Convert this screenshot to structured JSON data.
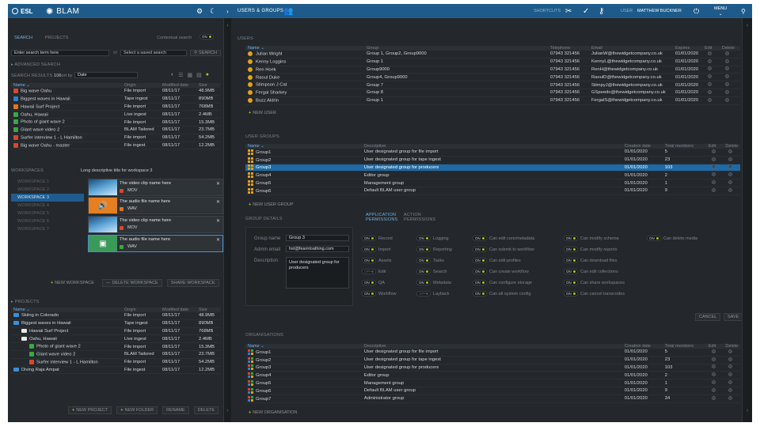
{
  "topbar": {
    "brand": "ESL",
    "app": "BLAM",
    "section": "USERS & GROUPS",
    "shortcuts": "SHORTCUTS",
    "user_label": "USER",
    "user_name": "MATTHEW BUCKNER",
    "menu": "MENU"
  },
  "left": {
    "tabs": [
      "SEARCH",
      "PROJECTS"
    ],
    "contextual": "Contextual search",
    "ctx_state": "ON",
    "search_placeholder": "Enter search term here",
    "or": "or",
    "saved_placeholder": "Select a saved search",
    "search_btn": "SEARCH",
    "advanced": "ADVANCED SEARCH",
    "results_label": "SEARCH RESULTS",
    "results_count": "106",
    "sort_label": "Sort by",
    "sort_value": "Date",
    "results_headers": [
      "Name",
      "Origin",
      "Modified date",
      "Size"
    ],
    "results": [
      {
        "icon": "red",
        "name": "Big wave Oahu",
        "origin": "File import",
        "date": "08/11/17",
        "size": "48.9MB"
      },
      {
        "icon": "blue",
        "name": "Biggest waves in Hawaii",
        "origin": "Tape ingest",
        "date": "08/11/17",
        "size": "890MB"
      },
      {
        "icon": "orange",
        "name": "Hawaii Surf Project",
        "origin": "File import",
        "date": "08/11/17",
        "size": "768MB"
      },
      {
        "icon": "green",
        "name": "Oahu, Hawaii",
        "origin": "Live ingest",
        "date": "08/11/17",
        "size": "2.4MB"
      },
      {
        "icon": "green",
        "name": "Photo of giant wave 2",
        "origin": "File import",
        "date": "08/11/17",
        "size": "15.3MB"
      },
      {
        "icon": "green",
        "name": "Giant wave video 2",
        "origin": "BLAM Tailored",
        "date": "08/11/17",
        "size": "23.7MB"
      },
      {
        "icon": "red",
        "name": "Surfer interview 1 - L Hamilton",
        "origin": "File import",
        "date": "08/11/17",
        "size": "54.2MB"
      },
      {
        "icon": "red",
        "name": "Big wave Oahu - master",
        "origin": "File ingest",
        "date": "08/11/17",
        "size": "12.2MB"
      }
    ],
    "workspaces_label": "WORKSPACES",
    "ws_title": "Long descriptive title for workspace 3",
    "workspaces": [
      "WORKSPACE 1",
      "WORKSPACE 2",
      "WORKSPACE 3",
      "WORKSPACE 4",
      "WORKSPACE 5",
      "WORKSPACE 6",
      "WORKSPACE 7"
    ],
    "cards": [
      {
        "title": "The video clip name here",
        "type": "MOV",
        "kind": "video"
      },
      {
        "title": "The audio file name here",
        "type": "WAV",
        "kind": "audio"
      },
      {
        "title": "The video clip name here",
        "type": "MOV",
        "kind": "video"
      },
      {
        "title": "The audio file name here",
        "type": "WAV",
        "kind": "image"
      }
    ],
    "ws_buttons": [
      "NEW WORKSPACE",
      "DELETE WORKSPACE",
      "SHARE WORKSPACE"
    ],
    "projects_label": "PROJECTS",
    "projects_headers": [
      "Name",
      "Origin",
      "Modified date",
      "Size"
    ],
    "projects": [
      {
        "icon": "folder",
        "indent": 0,
        "name": "Skiing in Colorado",
        "origin": "File import",
        "date": "08/11/17",
        "size": "48.9MB"
      },
      {
        "icon": "folder",
        "indent": 0,
        "name": "Biggest waves in Hawaii",
        "origin": "Tape ingest",
        "date": "08/11/17",
        "size": "890MB"
      },
      {
        "icon": "folderw",
        "indent": 1,
        "name": "Hawaii Surf Project",
        "origin": "File import",
        "date": "08/11/17",
        "size": "768MB"
      },
      {
        "icon": "folderw",
        "indent": 1,
        "name": "Oahu, Hawaii",
        "origin": "Live ingest",
        "date": "08/11/17",
        "size": "2.4MB"
      },
      {
        "icon": "green",
        "indent": 2,
        "name": "Photo of giant wave 2",
        "origin": "File import",
        "date": "08/11/17",
        "size": "15.3MB"
      },
      {
        "icon": "green",
        "indent": 2,
        "name": "Giant wave video 2",
        "origin": "BLAM Tailored",
        "date": "08/11/17",
        "size": "23.7MB"
      },
      {
        "icon": "red",
        "indent": 2,
        "name": "Surfer interview 1 - L Hamilton",
        "origin": "File import",
        "date": "08/11/17",
        "size": "54.2MB"
      },
      {
        "icon": "folder",
        "indent": 0,
        "name": "Diving Raja Ampat",
        "origin": "File ingest",
        "date": "08/11/17",
        "size": "12.2MB"
      }
    ],
    "proj_buttons": [
      "NEW PROJECT",
      "NEW FOLDER",
      "RENAME",
      "DELETE"
    ]
  },
  "users": {
    "label": "USERS",
    "headers": [
      "Name",
      "Group",
      "Telephone",
      "Email",
      "Expires",
      "Edit",
      "Delete"
    ],
    "rows": [
      {
        "name": "Julian Wright",
        "group": "Group 1, Group2, Group9000",
        "tel": "07943 321456",
        "email": "JulianW@thewidgetcompany.co.uk",
        "exp": "01/01/2020"
      },
      {
        "name": "Kenny Loggins",
        "group": "Group 1",
        "tel": "07943 321456",
        "email": "KennyL@thewidgetcompany.co.uk",
        "exp": "01/01/2020"
      },
      {
        "name": "Ren Hoek",
        "group": "Group9000",
        "tel": "07943 321456",
        "email": "RenH@thewidgetcompany.co.uk",
        "exp": "01/01/2020"
      },
      {
        "name": "Raoul Duke",
        "group": "Group4, Group9000",
        "tel": "07943 321456",
        "email": "RaoulD@thewidgetcompany.co.uk",
        "exp": "01/01/2020"
      },
      {
        "name": "Stimpson J Cat",
        "group": "Group 7",
        "tel": "07943 321456",
        "email": "StimpyJ@thewidgetcompany.co.uk",
        "exp": "01/01/2020"
      },
      {
        "name": "Fergal Sharkey",
        "group": "Group 8",
        "tel": "07943 321456",
        "email": "GSpeedo@thewidgetcompany.co.uk",
        "exp": "01/01/2020"
      },
      {
        "name": "Buzz Aldrin",
        "group": "Group 1",
        "tel": "07943 321456",
        "email": "FergalS@thewidgetcompany.co.uk",
        "exp": "01/01/2020"
      }
    ],
    "new_btn": "NEW USER"
  },
  "groups": {
    "label": "USER GROUPS",
    "headers": [
      "Name",
      "Description",
      "Creation date",
      "Total members",
      "Edit",
      "Delete"
    ],
    "rows": [
      {
        "name": "Group1",
        "desc": "User designated group for file import",
        "date": "01/01/2020",
        "members": "5"
      },
      {
        "name": "Group2",
        "desc": "User designated group for tape ingest",
        "date": "01/01/2020",
        "members": "23"
      },
      {
        "name": "Group3",
        "desc": "User designated group for producers",
        "date": "01/01/2020",
        "members": "103"
      },
      {
        "name": "Group4",
        "desc": "Editor group",
        "date": "01/01/2020",
        "members": "2"
      },
      {
        "name": "Group5",
        "desc": "Management group",
        "date": "01/01/2020",
        "members": "1"
      },
      {
        "name": "Group6",
        "desc": "Default BLAM user group",
        "date": "01/01/2020",
        "members": "9"
      }
    ],
    "selected": 2,
    "new_btn": "NEW USER GROUP"
  },
  "details": {
    "label": "GROUP DETAILS",
    "tab1": "APPLICATION PERMISSIONS",
    "tab2": "ACTION PERMISSIONS",
    "name_label": "Group name",
    "name_value": "Group 3",
    "email_label": "Admin email",
    "email_value": "hst@fearnloathing.com",
    "desc_label": "Description",
    "desc_value": "User designated group for producers",
    "perms": [
      [
        {
          "s": "ON",
          "l": "Record"
        },
        {
          "s": "ON",
          "l": "Import"
        },
        {
          "s": "ON",
          "l": "Assets"
        },
        {
          "s": "OFF",
          "l": "Edit"
        },
        {
          "s": "ON",
          "l": "QA"
        },
        {
          "s": "ON",
          "l": "Workflow"
        }
      ],
      [
        {
          "s": "ON",
          "l": "Logging"
        },
        {
          "s": "ON",
          "l": "Reporting"
        },
        {
          "s": "ON",
          "l": "Tasks"
        },
        {
          "s": "ON",
          "l": "Search"
        },
        {
          "s": "ON",
          "l": "Metadata"
        },
        {
          "s": "OFF",
          "l": "Layback"
        }
      ],
      [
        {
          "s": "ON",
          "l": "Can edit core/metadata"
        },
        {
          "s": "ON",
          "l": "Can submit to workflow"
        },
        {
          "s": "ON",
          "l": "Can edit profiles"
        },
        {
          "s": "ON",
          "l": "Can create workflow"
        },
        {
          "s": "ON",
          "l": "Can configure storage"
        },
        {
          "s": "ON",
          "l": "Can alt system config"
        }
      ],
      [
        {
          "s": "ON",
          "l": "Can modify schema"
        },
        {
          "s": "ON",
          "l": "Can modify reports"
        },
        {
          "s": "ON",
          "l": "Can download files"
        },
        {
          "s": "ON",
          "l": "Can edit collections"
        },
        {
          "s": "ON",
          "l": "Can share workspaces"
        },
        {
          "s": "ON",
          "l": "Can cancel transcodes"
        }
      ],
      [
        {
          "s": "ON",
          "l": "Can delete media"
        }
      ]
    ],
    "cancel": "CANCEL",
    "save": "SAVE"
  },
  "orgs": {
    "label": "ORGANISATIONS",
    "headers": [
      "Name",
      "Description",
      "Creation date",
      "Total members",
      "Edit",
      "Delete"
    ],
    "rows": [
      {
        "name": "Group1",
        "desc": "User designated group for file import",
        "date": "01/01/2020",
        "members": "5"
      },
      {
        "name": "Group2",
        "desc": "User designated group for tape ingest",
        "date": "01/01/2020",
        "members": "23"
      },
      {
        "name": "Group3",
        "desc": "User designated group for producers",
        "date": "01/01/2020",
        "members": "103"
      },
      {
        "name": "Group4",
        "desc": "Editor group",
        "date": "01/01/2020",
        "members": "2"
      },
      {
        "name": "Group5",
        "desc": "Management group",
        "date": "01/01/2020",
        "members": "1"
      },
      {
        "name": "Group6",
        "desc": "Default BLAM user group",
        "date": "01/01/2020",
        "members": "9"
      },
      {
        "name": "Group7",
        "desc": "Administrator group",
        "date": "01/01/2020",
        "members": "34"
      }
    ],
    "new_btn": "NEW ORGANISATION"
  }
}
